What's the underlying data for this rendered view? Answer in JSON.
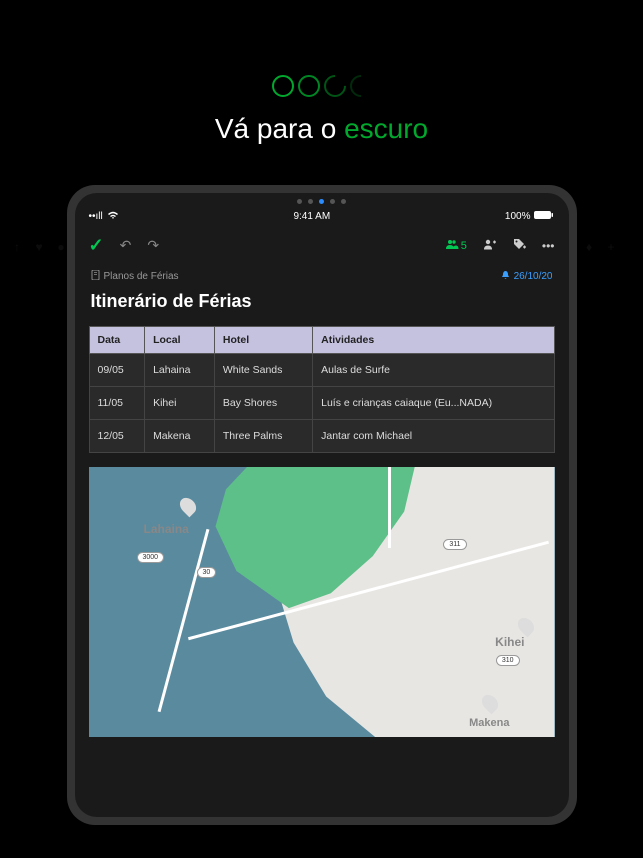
{
  "tagline": {
    "prefix": "Vá para o ",
    "accent": "escuro"
  },
  "statusbar": {
    "time": "9:41 AM",
    "battery": "100%"
  },
  "toolbar": {
    "share_count": "5"
  },
  "breadcrumb": {
    "label": "Planos de Férias"
  },
  "reminder": {
    "date": "26/10/20"
  },
  "note": {
    "title": "Itinerário de Férias"
  },
  "table": {
    "headers": [
      "Data",
      "Local",
      "Hotel",
      "Atividades"
    ],
    "rows": [
      [
        "09/05",
        "Lahaina",
        "White Sands",
        "Aulas de Surfe"
      ],
      [
        "11/05",
        "Kihei",
        "Bay Shores",
        "Luís e crianças caiaque (Eu...NADA)"
      ],
      [
        "12/05",
        "Makena",
        "Three Palms",
        "Jantar com Michael"
      ]
    ]
  },
  "map": {
    "labels": {
      "lahaina": "Lahaina",
      "kihei": "Kihei",
      "makena": "Makena"
    },
    "routes": {
      "r1": "3000",
      "r2": "30",
      "r3": "311",
      "r4": "310"
    }
  }
}
